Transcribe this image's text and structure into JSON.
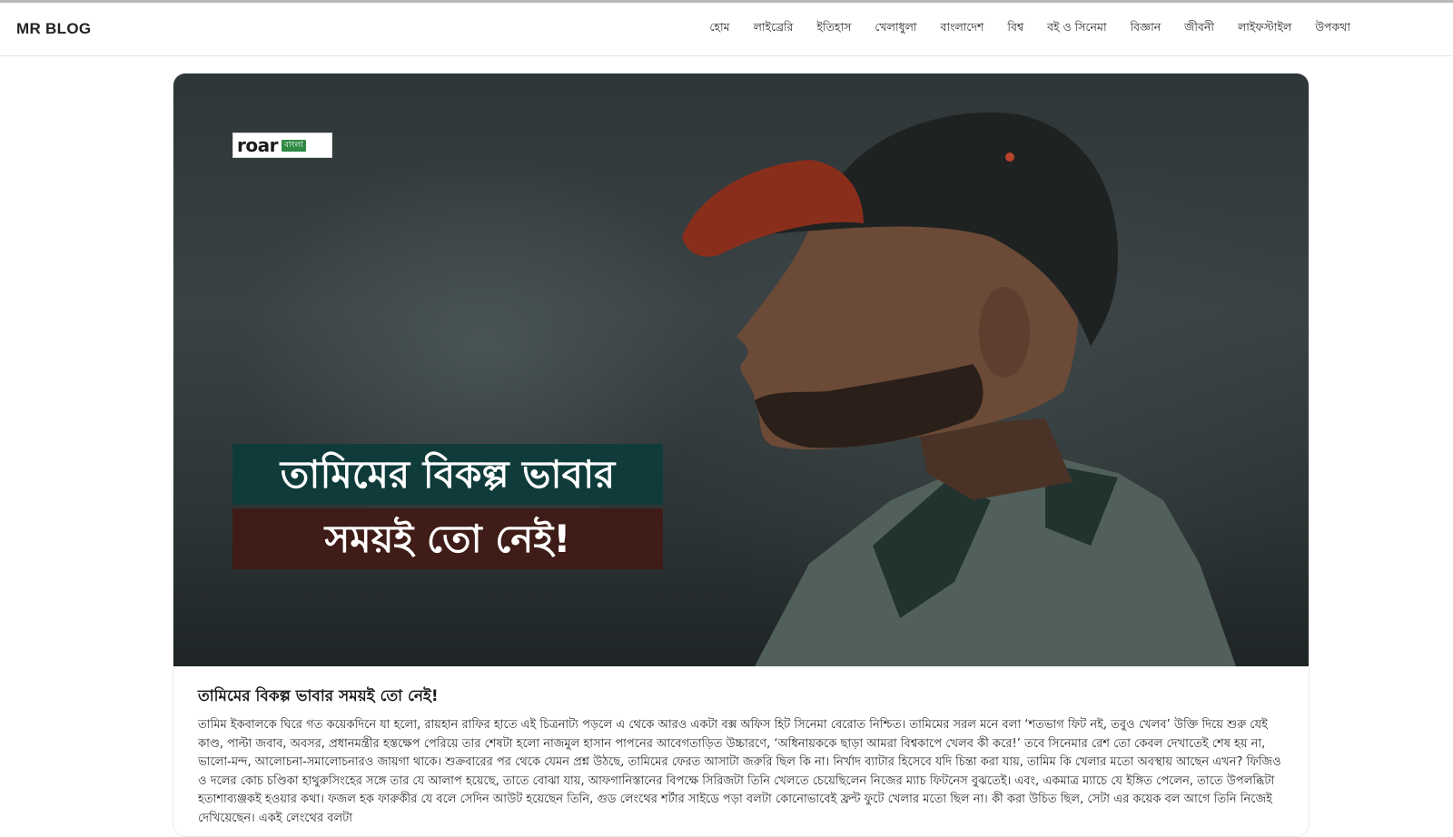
{
  "site": {
    "brand": "MR BLOG"
  },
  "nav": {
    "items": [
      {
        "label": "হোম"
      },
      {
        "label": "লাইব্রেরি"
      },
      {
        "label": "ইতিহাস"
      },
      {
        "label": "খেলাধুলা"
      },
      {
        "label": "বাংলাদেশ"
      },
      {
        "label": "বিশ্ব"
      },
      {
        "label": "বই ও সিনেমা"
      },
      {
        "label": "বিজ্ঞান"
      },
      {
        "label": "জীবনী"
      },
      {
        "label": "লাইফস্টাইল"
      },
      {
        "label": "উপকথা"
      }
    ]
  },
  "hero": {
    "logo_word": "roar",
    "logo_tag": "বাংলা",
    "headline_line1": "তামিমের বিকল্প ভাবার",
    "headline_line2": "সময়ই তো নেই!",
    "colors": {
      "line1_bg": "#0f3c3b",
      "line2_bg": "#3f1c17",
      "logo_tag_bg": "#2f8a43"
    }
  },
  "article": {
    "title": "তামিমের বিকল্প ভাবার সময়ই তো নেই!",
    "body": "তামিম ইকবালকে ঘিরে গত কয়েকদিনে যা হলো, রায়হান রাফির হাতে এই চিত্রনাট্য পড়লে এ থেকে আরও একটা বক্স অফিস হিট সিনেমা বেরোত নিশ্চিত। তামিমের সরল মনে বলা ‘শতভাগ ফিট নই, তবুও খেলব’ উক্তি দিয়ে শুরু যেই কাণ্ড, পাল্টা জবাব, অবসর, প্রধানমন্ত্রীর হস্তক্ষেপ পেরিয়ে তার শেষটা হলো নাজমুল হাসান পাপনের আবেগতাড়িত উচ্চারণে, ‘অধিনায়ককে ছাড়া আমরা বিশ্বকাপে খেলব কী করে!’ তবে সিনেমার রেশ তো কেবল দেখাতেই শেষ হয় না, ভালো-মন্দ, আলোচনা-সমালোচনারও জায়গা থাকে। শুক্রবারের পর থেকে যেমন প্রশ্ন উঠছে, তামিমের ফেরত আসাটা জরুরি ছিল কি না। নির্খাদ ব্যাটার হিসেবে যদি চিন্তা করা যায়, তামিম কি খেলার মতো অবস্থায় আছেন এখন? ফিজিও ও দলের কোচ চণ্ডিকা হাথুরুসিংহের সঙ্গে তার যে আলাপ হয়েছে, তাতে বোঝা যায়, আফগানিস্তানের বিপক্ষে সিরিজটা তিনি খেলতে চেয়েছিলেন নিজের ম্যাচ ফিটনেস বুঝতেই। এবং, একমাত্র ম্যাচে যে ইঙ্গিত পেলেন, তাতে উপলব্ধিটা হতাশাব্যঞ্জকই হওয়ার কথা। ফজল হক ফারুকীর যে বলে সেদিন আউট হয়েছেন তিনি, গুড লেংথের শর্টার সাইডে পড়া বলটা কোনোভাবেই ফ্রন্ট ফুটে খেলার মতো ছিল না। কী করা উচিত ছিল, সেটা এর কয়েক বল আগে তিনি নিজেই দেখিয়েছেন। একই লেংথের বলটা"
  }
}
